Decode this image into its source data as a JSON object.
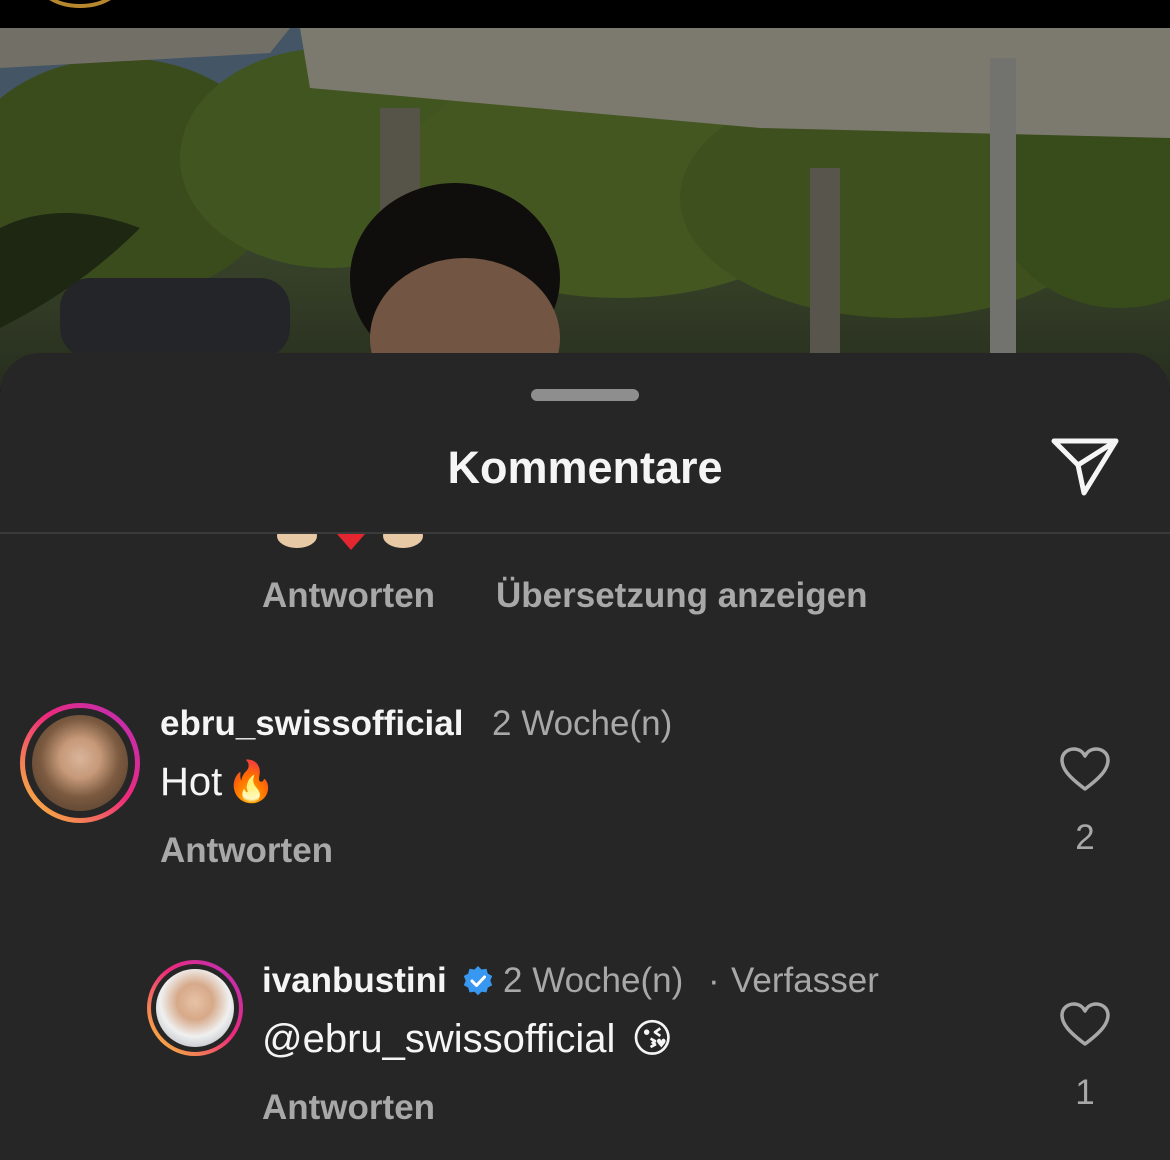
{
  "header": {
    "title": "Kommentare",
    "share_icon": "paper-plane-icon"
  },
  "previous_comment": {
    "reply_label": "Antworten",
    "translate_label": "Übersetzung anzeigen"
  },
  "comments": [
    {
      "username": "ebru_swissofficial",
      "time": "2 Woche(n)",
      "text": "Hot",
      "emoji": "🔥",
      "reply_label": "Antworten",
      "likes": "2"
    },
    {
      "username": "ivanbustini",
      "verified": true,
      "time": "2 Woche(n)",
      "separator": "·",
      "role": "Verfasser",
      "text": "@ebru_swissofficial",
      "emoji": "😘",
      "reply_label": "Antworten",
      "likes": "1"
    }
  ],
  "colors": {
    "sheet_bg": "#262626",
    "primary_text": "#f5f5f5",
    "secondary_text": "#a8a8a8",
    "verified_blue": "#3897f0"
  }
}
